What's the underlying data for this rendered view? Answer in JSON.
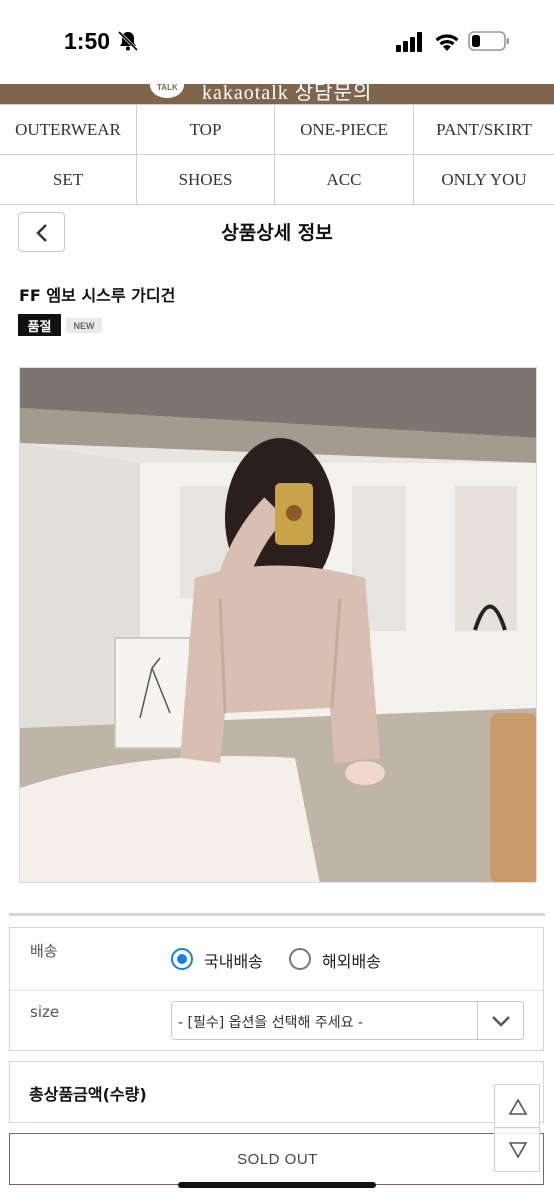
{
  "status_bar": {
    "time": "1:50"
  },
  "kakao_banner": {
    "text": "kakaotalk 상담문의",
    "bubble_text": "TALK"
  },
  "categories": [
    "OUTERWEAR",
    "TOP",
    "ONE-PIECE",
    "PANT/SKIRT",
    "SET",
    "SHOES",
    "ACC",
    "ONLY YOU"
  ],
  "header": {
    "title": "상품상세 정보"
  },
  "product": {
    "name": "FF 엠보 시스루 가디건",
    "soldout_badge": "품절",
    "new_badge": "NEW"
  },
  "options": {
    "shipping_label": "배송",
    "domestic_label": "국내배송",
    "overseas_label": "해외배송",
    "selected_shipping": "국내배송",
    "size_label": "size",
    "size_placeholder": "- [필수] 옵션을 선택해 주세요 -"
  },
  "total": {
    "label": "총상품금액(수량)"
  },
  "soldout_button": {
    "label": "SOLD OUT"
  },
  "colors": {
    "brand_brown": "#80654d",
    "radio_blue": "#1a7fe0"
  }
}
